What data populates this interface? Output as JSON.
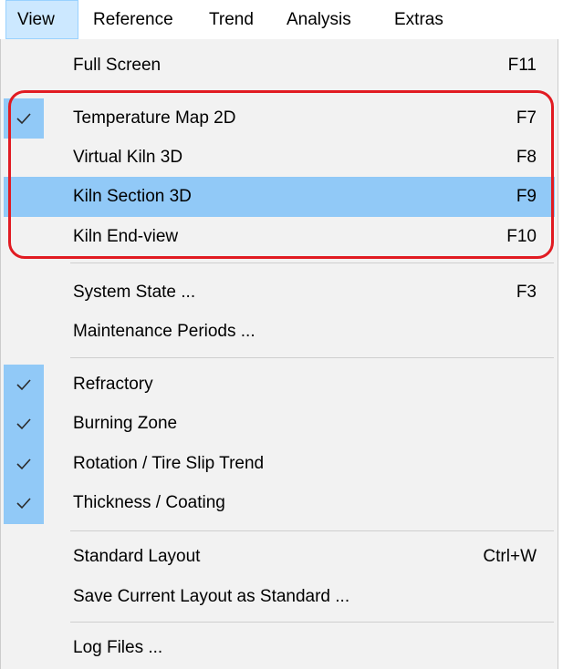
{
  "menubar": {
    "items": [
      "View",
      "Reference",
      "Trend",
      "Analysis",
      "Extras"
    ]
  },
  "menu": {
    "full_screen": {
      "label": "Full Screen",
      "shortcut": "F11"
    },
    "temperature_map": {
      "label": "Temperature Map 2D",
      "shortcut": "F7",
      "checked": true
    },
    "virtual_kiln": {
      "label": "Virtual Kiln 3D",
      "shortcut": "F8"
    },
    "kiln_section": {
      "label": "Kiln Section 3D",
      "shortcut": "F9"
    },
    "kiln_end_view": {
      "label": "Kiln End-view",
      "shortcut": "F10"
    },
    "system_state": {
      "label": "System State ...",
      "shortcut": "F3"
    },
    "maintenance_periods": {
      "label": "Maintenance Periods ..."
    },
    "refractory": {
      "label": "Refractory",
      "checked": true
    },
    "burning_zone": {
      "label": "Burning Zone",
      "checked": true
    },
    "rotation_tire_slip": {
      "label": "Rotation / Tire Slip Trend",
      "checked": true
    },
    "thickness_coating": {
      "label": "Thickness / Coating",
      "checked": true
    },
    "standard_layout": {
      "label": "Standard Layout",
      "shortcut": "Ctrl+W"
    },
    "save_layout": {
      "label": "Save Current Layout as Standard ..."
    },
    "log_files": {
      "label": "Log Files ..."
    }
  },
  "colors": {
    "highlight": "#91c9f7",
    "annotation_box": "#e11b22",
    "menu_background": "#f2f2f2"
  },
  "icons": {
    "check": "check-icon"
  }
}
